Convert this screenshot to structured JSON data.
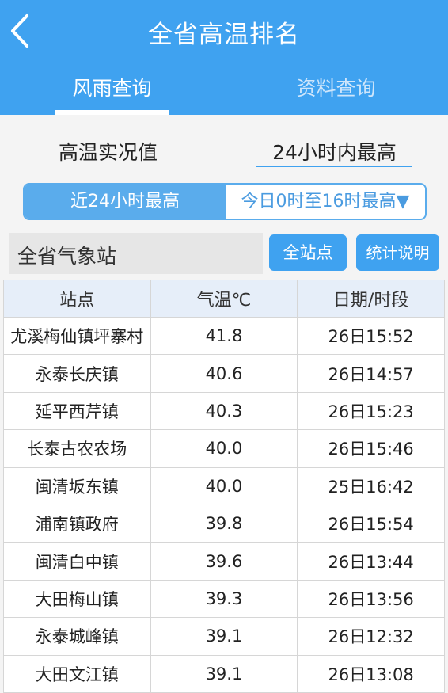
{
  "header": {
    "title": "全省高温排名",
    "tabs": [
      {
        "label": "风雨查询",
        "active": true
      },
      {
        "label": "资料查询",
        "active": false
      }
    ]
  },
  "subtabs": {
    "left": "高温实况值",
    "right": "24小时内最高"
  },
  "segment": {
    "left": "近24小时最高",
    "right": "今日0时至16时最高",
    "arrow": "▼"
  },
  "filter": {
    "station_scope": "全省气象站",
    "all_button": "全站点",
    "stat_button": "统计说明"
  },
  "table": {
    "headers": [
      "站点",
      "气温℃",
      "日期/时段"
    ],
    "rows": [
      [
        "尤溪梅仙镇坪寨村",
        "41.8",
        "26日15:52"
      ],
      [
        "永泰长庆镇",
        "40.6",
        "26日14:57"
      ],
      [
        "延平西芹镇",
        "40.3",
        "26日15:23"
      ],
      [
        "长泰古农农场",
        "40.0",
        "26日15:46"
      ],
      [
        "闽清坂东镇",
        "40.0",
        "25日16:42"
      ],
      [
        "浦南镇政府",
        "39.8",
        "26日15:54"
      ],
      [
        "闽清白中镇",
        "39.6",
        "26日13:44"
      ],
      [
        "大田梅山镇",
        "39.3",
        "26日13:56"
      ],
      [
        "永泰城峰镇",
        "39.1",
        "26日12:32"
      ],
      [
        "大田文江镇",
        "39.1",
        "26日13:08"
      ]
    ]
  },
  "colors": {
    "header_bg": "#3fa2f0",
    "accent": "#5aacec"
  }
}
